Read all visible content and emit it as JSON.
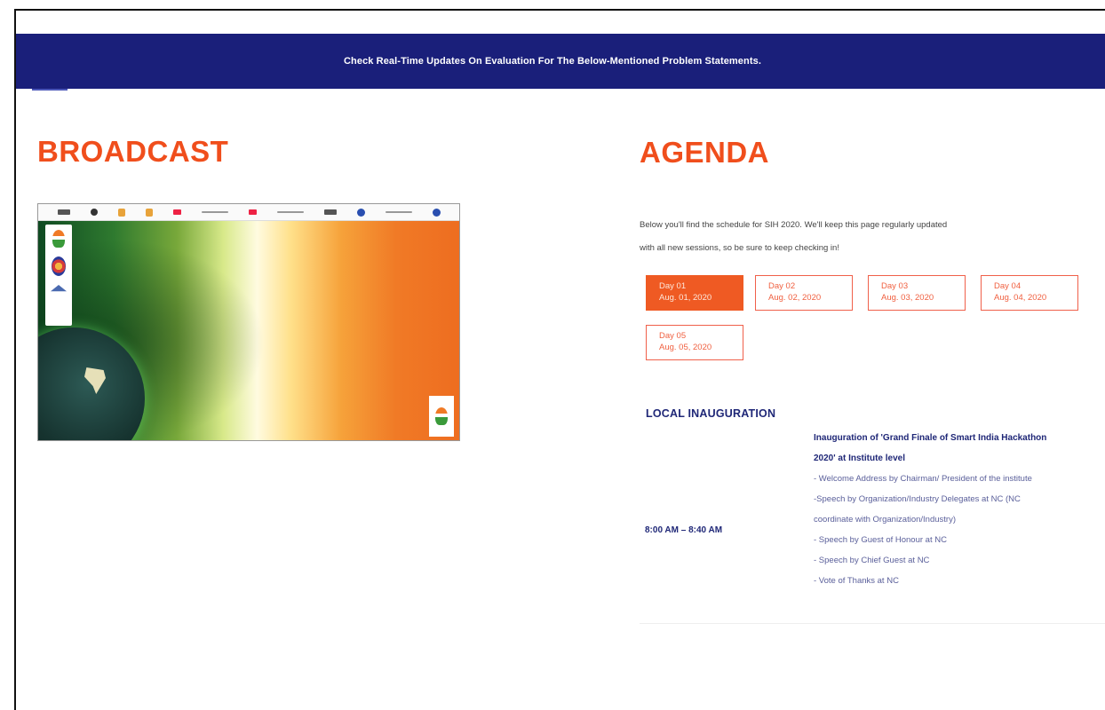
{
  "banner": {
    "text": "Check Real-Time Updates On Evaluation For The Below-Mentioned Problem Statements."
  },
  "broadcast": {
    "title": "BROADCAST"
  },
  "agenda": {
    "title": "AGENDA",
    "description_line1": "Below you'll find the schedule for SIH 2020. We'll keep this page regularly updated",
    "description_line2": "with all new sessions, so be sure to keep checking in!",
    "days": [
      {
        "label": "Day 01",
        "date": "Aug. 01, 2020",
        "active": true
      },
      {
        "label": "Day 02",
        "date": "Aug. 02, 2020",
        "active": false
      },
      {
        "label": "Day 03",
        "date": "Aug. 03, 2020",
        "active": false
      },
      {
        "label": "Day 04",
        "date": "Aug. 04, 2020",
        "active": false
      },
      {
        "label": "Day 05",
        "date": "Aug. 05, 2020",
        "active": false
      }
    ],
    "section_title": "LOCAL INAUGURATION",
    "session": {
      "time": "8:00 AM – 8:40 AM",
      "title_line1": "Inauguration of 'Grand Finale of Smart India Hackathon",
      "title_line2": "2020' at Institute level",
      "items": [
        "- Welcome Address by Chairman/ President of the institute",
        "-Speech by Organization/Industry Delegates at NC (NC",
        "coordinate with Organization/Industry)",
        "- Speech by Guest of Honour at NC",
        "- Speech by Chief Guest at NC",
        "- Vote of Thanks at NC"
      ]
    }
  },
  "colors": {
    "banner_bg": "#1a1f7a",
    "accent_orange": "#f04e1c",
    "navy_text": "#1f2777"
  }
}
